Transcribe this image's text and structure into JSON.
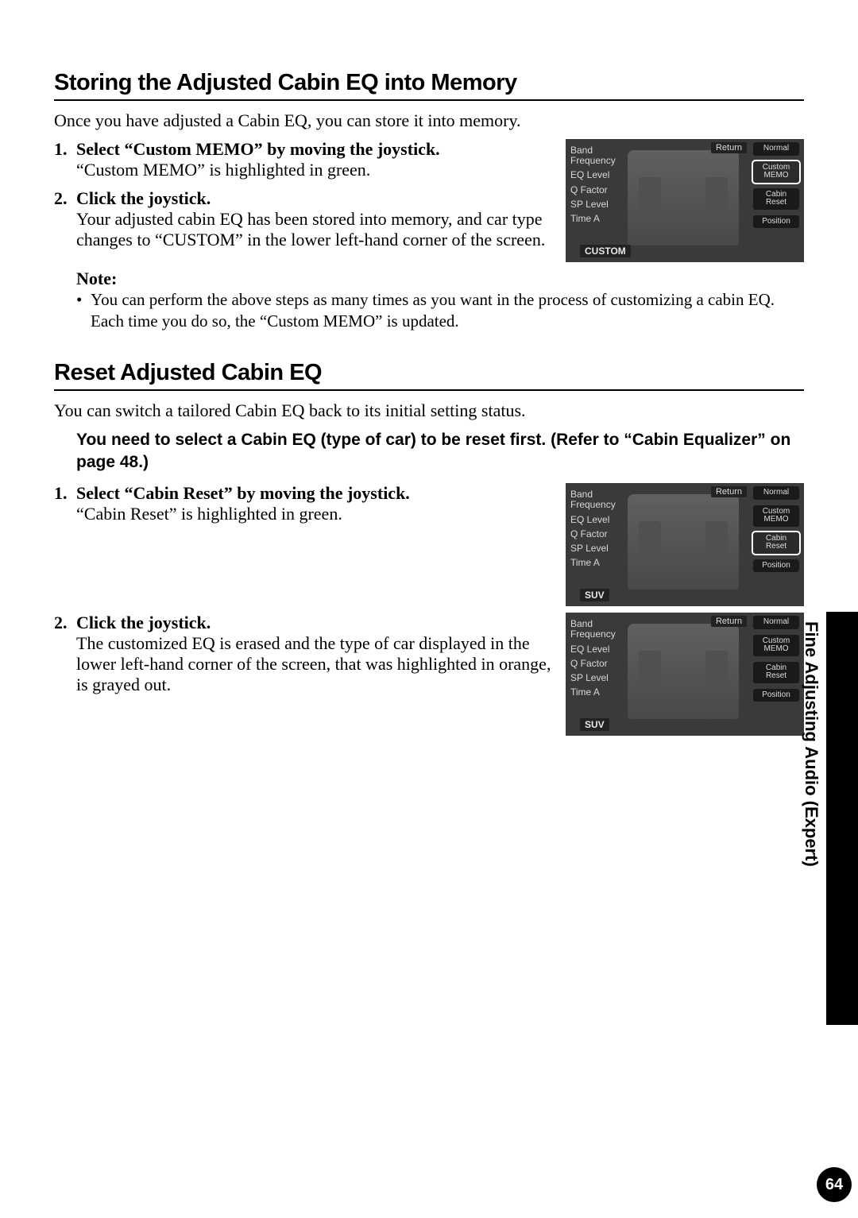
{
  "side_tab": "Fine Adjusting Audio (Expert)",
  "page_number": "64",
  "shot_common": {
    "labels": [
      "Band\nFrequency",
      "EQ Level",
      "Q Factor",
      "SP Level",
      "Time A"
    ],
    "return": "Return",
    "buttons": [
      "Normal",
      "Custom\nMEMO",
      "Cabin\nReset",
      "Position"
    ]
  },
  "section1": {
    "title": "Storing the Adjusted Cabin EQ into Memory",
    "intro": "Once you have adjusted a Cabin EQ, you can store it into memory.",
    "step1_head": "Select “Custom MEMO” by moving the joystick.",
    "step1_desc": "“Custom MEMO” is highlighted in green.",
    "step2_head": "Click the joystick.",
    "step2_desc": "Your adjusted cabin EQ has been stored into memory, and car type changes to “CUSTOM” in the lower left-hand corner of the screen.",
    "note_label": "Note:",
    "note_text": "You can perform the above steps as many times as you want in the process of customizing a cabin EQ. Each time you do so, the “Custom MEMO” is updated.",
    "cartype": "CUSTOM",
    "highlight_index": 1
  },
  "section2": {
    "title": "Reset Adjusted Cabin EQ",
    "intro": "You can switch a tailored Cabin EQ back to its initial setting status.",
    "crossref": "You need to select a Cabin EQ (type of car) to be reset first. (Refer to “Cabin Equalizer” on page 48.)",
    "step1_head": "Select “Cabin Reset” by moving the joystick.",
    "step1_desc": "“Cabin Reset” is highlighted in green.",
    "step2_head": "Click the joystick.",
    "step2_desc": "The customized EQ is erased and the type of car displayed in the lower left-hand corner of the screen, that was highlighted in orange, is grayed out.",
    "cartype": "SUV",
    "highlight_index": 2
  }
}
